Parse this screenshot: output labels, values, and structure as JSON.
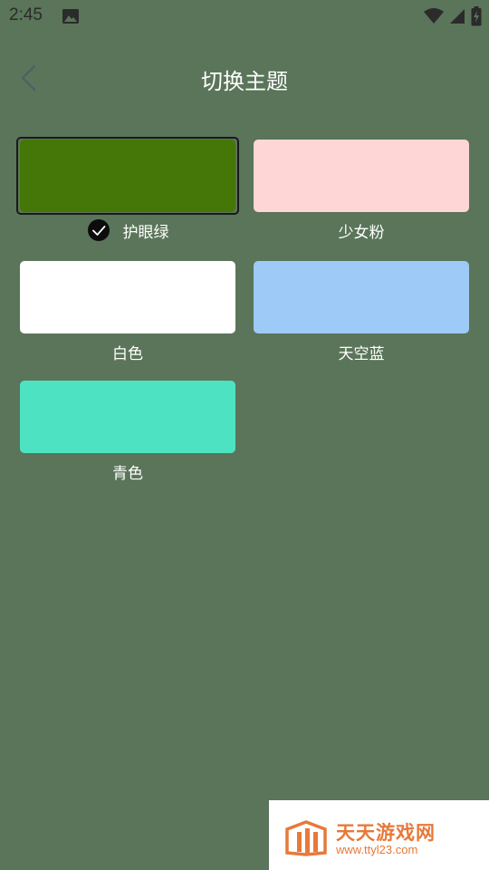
{
  "status_bar": {
    "time": "2:45",
    "icons": [
      "gallery-icon",
      "wifi-icon",
      "signal-icon",
      "battery-charging-icon"
    ]
  },
  "header": {
    "back_icon": "chevron-left-icon",
    "title": "切换主题"
  },
  "themes": [
    {
      "label": "护眼绿",
      "color": "#447707",
      "selected": true
    },
    {
      "label": "少女粉",
      "color": "#ffd6d6",
      "selected": false
    },
    {
      "label": "白色",
      "color": "#ffffff",
      "selected": false
    },
    {
      "label": "天空蓝",
      "color": "#9dcaf6",
      "selected": false
    },
    {
      "label": "青色",
      "color": "#4de3c2",
      "selected": false
    }
  ],
  "watermark": {
    "name": "天天游戏网",
    "url": "www.ttyl23.com",
    "color": "#e7793a"
  }
}
